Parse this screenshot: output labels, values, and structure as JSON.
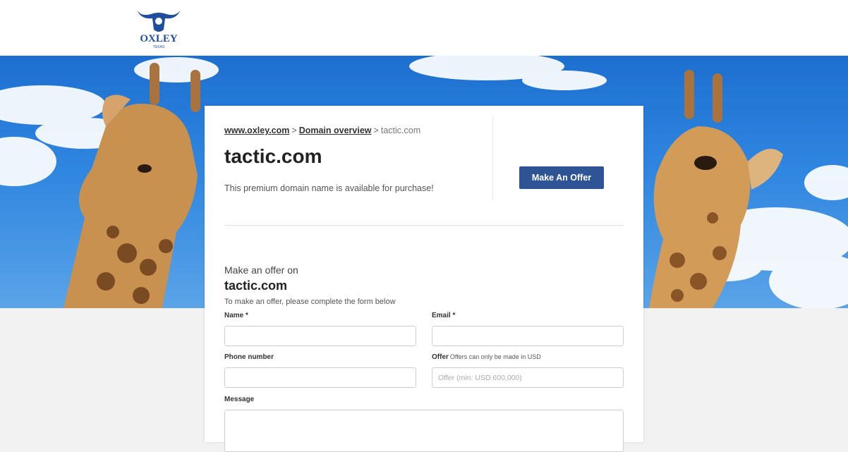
{
  "header": {
    "logo_text": "OXLEY",
    "logo_subtext": "TEXAS"
  },
  "breadcrumb": {
    "home": "www.oxley.com",
    "separator1": ">",
    "overview": "Domain overview",
    "separator2": ">",
    "current": "tactic.com"
  },
  "domain": {
    "name": "tactic.com",
    "tagline": "This premium domain name is available for purchase!",
    "offer_button": "Make An Offer"
  },
  "form": {
    "heading": "Make an offer on",
    "domain": "tactic.com",
    "intro": "To make an offer, please complete the form below",
    "name_label": "Name *",
    "email_label": "Email *",
    "phone_label": "Phone number",
    "offer_label": "Offer",
    "offer_note": "Offers can only be made in USD",
    "offer_placeholder": "Offer (min: USD 600,000)",
    "message_label": "Message"
  },
  "colors": {
    "button": "#2f5496",
    "sky": "#2f86e0",
    "logo": "#1f4e9c"
  }
}
